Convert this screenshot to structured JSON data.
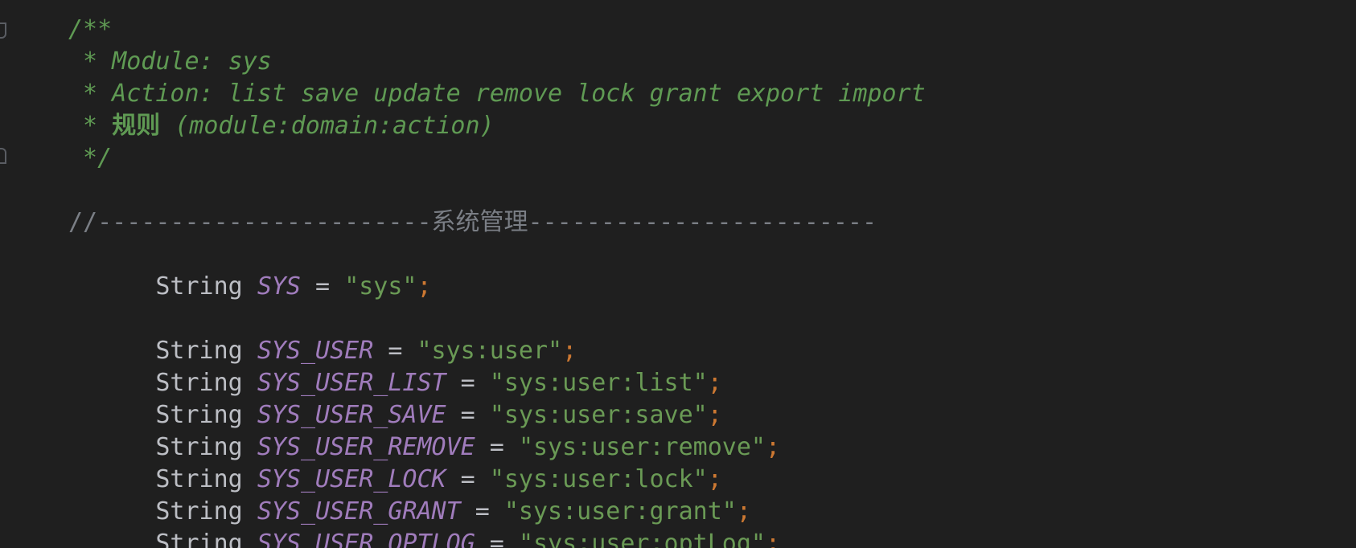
{
  "comment_block": {
    "open": "/**",
    "module_line": " * Module: sys",
    "action_line": " * Action: list save update remove lock grant export import",
    "rule_prefix": " * ",
    "rule_word": "规则",
    "rule_suffix": " (module:domain:action)",
    "close": " */"
  },
  "separator": {
    "left": "//-----------------------",
    "label": "系统管理",
    "right": "------------------------"
  },
  "declarations": [
    {
      "type": "String",
      "name": "SYS",
      "equals": " = ",
      "value": "\"sys\"",
      "semi": ";"
    },
    {
      "type": "String",
      "name": "SYS_USER",
      "equals": " = ",
      "value": "\"sys:user\"",
      "semi": ";"
    },
    {
      "type": "String",
      "name": "SYS_USER_LIST",
      "equals": " = ",
      "value": "\"sys:user:list\"",
      "semi": ";"
    },
    {
      "type": "String",
      "name": "SYS_USER_SAVE",
      "equals": " = ",
      "value": "\"sys:user:save\"",
      "semi": ";"
    },
    {
      "type": "String",
      "name": "SYS_USER_REMOVE",
      "equals": " = ",
      "value": "\"sys:user:remove\"",
      "semi": ";"
    },
    {
      "type": "String",
      "name": "SYS_USER_LOCK",
      "equals": " = ",
      "value": "\"sys:user:lock\"",
      "semi": ";"
    },
    {
      "type": "String",
      "name": "SYS_USER_GRANT",
      "equals": " = ",
      "value": "\"sys:user:grant\"",
      "semi": ";"
    },
    {
      "type": "String",
      "name": "SYS_USER_",
      "name_tail": "OPTLOG",
      "equals": " = ",
      "value": "\"sys:user:optLog\"",
      "semi": ";"
    }
  ],
  "colors": {
    "background": "#1f1f1f",
    "comment": "#5f9a53",
    "keyword": "#bcbec4",
    "constant": "#a07cbc",
    "string": "#6a9a55",
    "semicolon": "#cc7832",
    "separator": "#7a7e85"
  },
  "icons": {
    "fold_top": "fold-start-icon",
    "fold_bottom": "fold-end-icon"
  }
}
